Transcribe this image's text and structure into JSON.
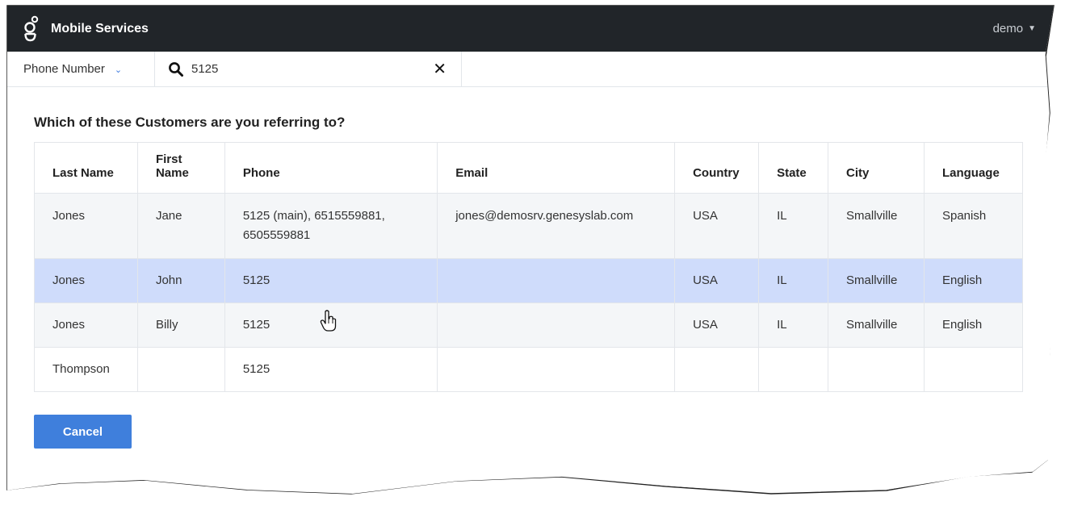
{
  "header": {
    "title": "Mobile Services",
    "user": "demo",
    "user_caret": "▼"
  },
  "search": {
    "field_select": "Phone Number",
    "field_chevron": "⌄",
    "query": "5125",
    "clear_glyph": "✕"
  },
  "main": {
    "question": "Which of these Customers are you referring to?",
    "table": {
      "columns": [
        "Last Name",
        "First Name",
        "Phone",
        "Email",
        "Country",
        "State",
        "City",
        "Language"
      ],
      "rows": [
        {
          "last_name": "Jones",
          "first_name": "Jane",
          "phone": "5125 (main), 6515559881, 6505559881",
          "email": "jones@demosrv.genesyslab.com",
          "country": "USA",
          "state": "IL",
          "city": "Smallville",
          "language": "Spanish"
        },
        {
          "last_name": "Jones",
          "first_name": "John",
          "phone": "5125",
          "email": "",
          "country": "USA",
          "state": "IL",
          "city": "Smallville",
          "language": "English"
        },
        {
          "last_name": "Jones",
          "first_name": "Billy",
          "phone": "5125",
          "email": "",
          "country": "USA",
          "state": "IL",
          "city": "Smallville",
          "language": "English"
        },
        {
          "last_name": "Thompson",
          "first_name": "",
          "phone": "5125",
          "email": "",
          "country": "",
          "state": "",
          "city": "",
          "language": ""
        }
      ]
    },
    "cancel_label": "Cancel"
  },
  "colors": {
    "topbar": "#212529",
    "selected_row": "#cfdcfb",
    "primary_button": "#3f7fdc",
    "chevron": "#3d7be0"
  }
}
